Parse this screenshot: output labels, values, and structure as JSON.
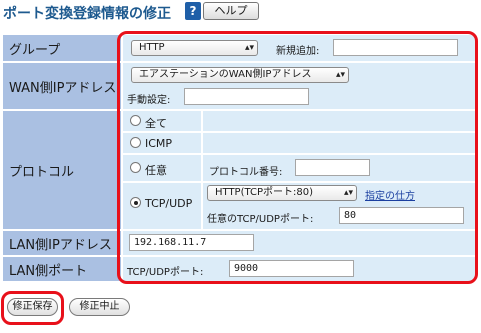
{
  "header": {
    "title": "ポート変換登録情報の修正",
    "help_icon": "?",
    "help_label": "ヘルプ"
  },
  "form": {
    "group": {
      "label": "グループ",
      "selected": "HTTP",
      "new_label": "新規追加:",
      "new_value": ""
    },
    "wan": {
      "label": "WAN側IPアドレス",
      "selected": "エアステーションのWAN側IPアドレス",
      "manual_label": "手動設定:",
      "manual_value": ""
    },
    "protocol": {
      "label": "プロトコル",
      "options": [
        {
          "label": "全て",
          "checked": false
        },
        {
          "label": "ICMP",
          "checked": false
        },
        {
          "label": "任意",
          "checked": false
        },
        {
          "label": "TCP/UDP",
          "checked": true
        }
      ],
      "proto_num_label": "プロトコル番号:",
      "proto_num_value": "",
      "tcp_selected": "HTTP(TCPポート:80)",
      "spec_link": "指定の仕方",
      "any_port_label": "任意のTCP/UDPポート:",
      "any_port_value": "80"
    },
    "lan_ip": {
      "label": "LAN側IPアドレス",
      "value": "192.168.11.7"
    },
    "lan_port": {
      "label": "LAN側ポート",
      "port_label": "TCP/UDPポート:",
      "port_value": "9000"
    }
  },
  "buttons": {
    "save": "修正保存",
    "cancel": "修正中止"
  },
  "colors": {
    "label_bg": "#aac0e2",
    "value_bg": "#dcecf8",
    "highlight": "#e8101a",
    "title": "#1e5a8f"
  }
}
